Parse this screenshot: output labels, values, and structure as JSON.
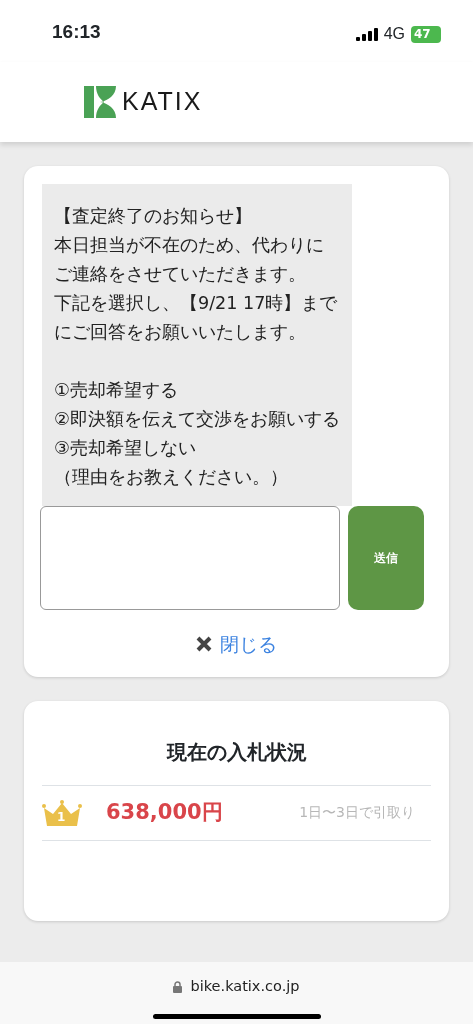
{
  "status_bar": {
    "time": "16:13",
    "network": "4G",
    "battery": "47"
  },
  "header": {
    "logo_text": "KATIX"
  },
  "notice": {
    "message_title": "【査定終了のお知らせ】",
    "paragraphs": [
      "本日担当が不在のため、代わりにご連絡をさせていただきます。",
      "下記を選択し、【9/21 17時】までにご回答をお願いいたします。"
    ],
    "options": [
      "①売却希望する",
      "②即決額を伝えて交渉をお願いする",
      "③売却希望しない"
    ],
    "option_note": "（理由をお教えください。）",
    "send_button": "送信",
    "close_link": "閉じる"
  },
  "bids": {
    "title": "現在の入札状況",
    "rows": [
      {
        "rank": "1",
        "price": "638,000円",
        "note": "1日〜3日で引取り"
      }
    ]
  },
  "browser_bar": {
    "url": "bike.katix.co.jp"
  }
}
